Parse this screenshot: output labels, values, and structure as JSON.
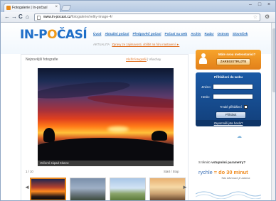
{
  "browser": {
    "tab_title": "Fotogalerie | In-počasí",
    "tab_close": "×",
    "window_controls": [
      "–",
      "□",
      "×"
    ],
    "nav": {
      "back": "←",
      "forward": "→",
      "reload": "C",
      "home": "⌂"
    },
    "url_domain": "www.in-pocasi.cz",
    "url_path": "/fotogalerie/velky-image-4/"
  },
  "site": {
    "logo_main": "IN-P",
    "logo_accent": "O",
    "logo_rest": "ČASÍ",
    "nav_items": [
      "Úvod",
      "Aktuální počasí",
      "Předpověď počasí",
      "Počasí na web",
      "Archiv",
      "Radar",
      "Ostrom",
      "Slovníček"
    ],
    "news_label": "AKTUALITA",
    "news_text": "Zpravy ze zajimavosti, oblíbit na fóru nastavení ►",
    "colors": {
      "brand_blue": "#1f6fc8",
      "accent_orange": "#f09a1a",
      "login_blue": "#1b5aa6"
    }
  },
  "gallery": {
    "section_title": "Nejnovější fotografie",
    "add_link": "Vložit fotografii",
    "filter_label": "Všechny",
    "caption": "Večerní západ Slunce",
    "counter": "1 / 10",
    "slideshow_label": "Start / Stop",
    "prev_arrow": "◄",
    "next_arrow": "►"
  },
  "sidebar": {
    "promo_question": "Máte svou meteostanici?",
    "promo_button": "ZAREGISTRUJTE",
    "login_title": "Přihlášení do webu",
    "login_labels": {
      "name": "Jméno:",
      "password": "Heslo:"
    },
    "remember_label": "Trvalé přihlášení",
    "login_button": "Přihlásit",
    "forgot_link": "Zapomněli jste heslo?"
  },
  "ad": {
    "line1_prefix": "S těmito",
    "line1_bold": "vstupními parametry?",
    "line2_prefix": "rychle",
    "line2_accent": "= do 30 minut",
    "line3": "Tato informace je zdarma"
  }
}
